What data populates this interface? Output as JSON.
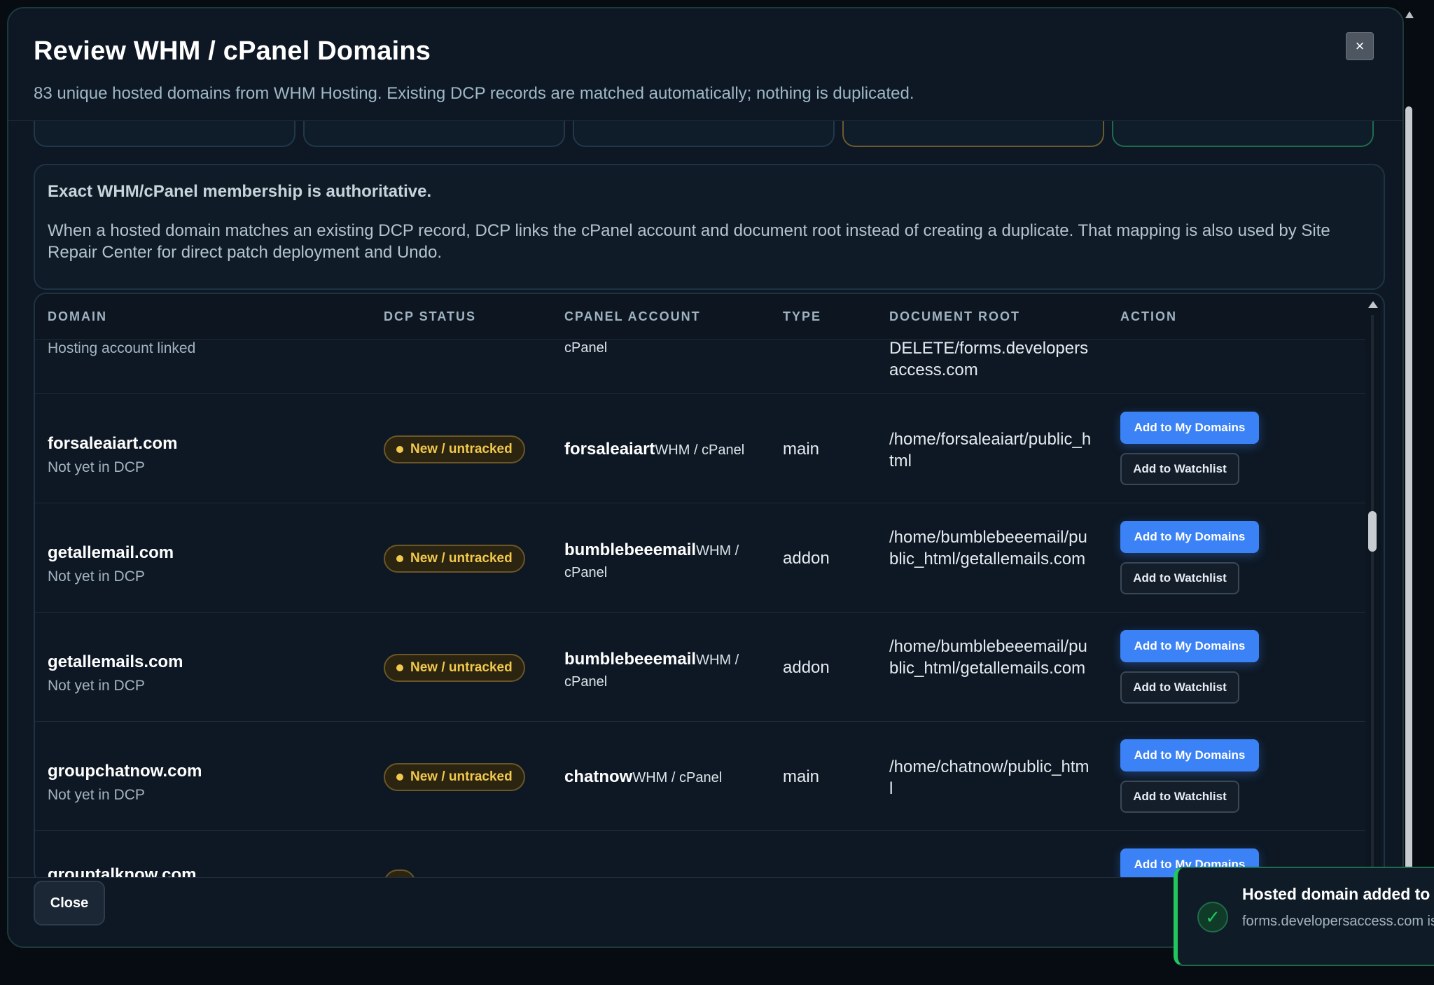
{
  "modal": {
    "title": "Review WHM / cPanel Domains",
    "subtitle": "83 unique hosted domains from WHM Hosting. Existing DCP records are matched automatically; nothing is duplicated.",
    "close_x": "×"
  },
  "info": {
    "title": "Exact WHM/cPanel membership is authoritative.",
    "text": "When a hosted domain matches an existing DCP record, DCP links the cPanel account and document root instead of creating a duplicate. That mapping is also used by Site Repair Center for direct patch deployment and Undo."
  },
  "table": {
    "headers": [
      "DOMAIN",
      "DCP STATUS",
      "CPANEL ACCOUNT",
      "TYPE",
      "DOCUMENT ROOT",
      "ACTION"
    ],
    "partial_row": {
      "sub": "Hosting account linked",
      "account_suffix": "cPanel",
      "docroot": "DELETE/forms.developersaccess.com"
    },
    "rows": [
      {
        "domain": "forsaleaiart.com",
        "sub": "Not yet in DCP",
        "status": "New / untracked",
        "account": "forsaleaiart",
        "account_suffix": "WHM / cPanel",
        "type": "main",
        "docroot": "/home/forsaleaiart/public_html"
      },
      {
        "domain": "getallemail.com",
        "sub": "Not yet in DCP",
        "status": "New / untracked",
        "account": "bumblebeeemail",
        "account_suffix": "WHM / cPanel",
        "type": "addon",
        "docroot": "/home/bumblebeeemail/public_html/getallemails.com"
      },
      {
        "domain": "getallemails.com",
        "sub": "Not yet in DCP",
        "status": "New / untracked",
        "account": "bumblebeeemail",
        "account_suffix": "WHM / cPanel",
        "type": "addon",
        "docroot": "/home/bumblebeeemail/public_html/getallemails.com"
      },
      {
        "domain": "groupchatnow.com",
        "sub": "Not yet in DCP",
        "status": "New / untracked",
        "account": "chatnow",
        "account_suffix": "WHM / cPanel",
        "type": "main",
        "docroot": "/home/chatnow/public_html"
      },
      {
        "domain": "grouptalknow.com"
      }
    ],
    "add_domains_label": "Add to My Domains",
    "add_watchlist_label": "Add to Watchlist"
  },
  "footer": {
    "close_label": "Close"
  },
  "toast": {
    "title": "Hosted domain added to",
    "text": "forms.developersaccess.com is WHM/cPanel account and rep"
  },
  "colors": {
    "accent": "#3b82f6",
    "warning": "#f2c94c",
    "success": "#22c55e"
  }
}
